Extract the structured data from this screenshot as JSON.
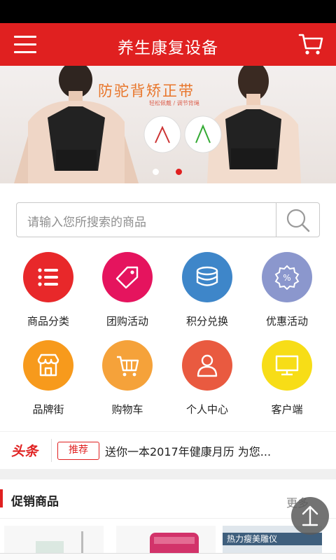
{
  "header": {
    "title": "养生康复设备",
    "menu_icon": "menu-icon",
    "cart_icon": "cart-icon",
    "color": "#e02020"
  },
  "banner": {
    "headline": "防驼背矫正带",
    "sub_text": "轻松佩戴 / 调节背绳",
    "active_dot": 2,
    "dot_count": 2
  },
  "search": {
    "placeholder": "请输入您所搜索的商品",
    "icon": "search-icon"
  },
  "categories": [
    {
      "label": "商品分类",
      "icon": "list-icon",
      "color": "#e8282a"
    },
    {
      "label": "团购活动",
      "icon": "tag-icon",
      "color": "#e5145e"
    },
    {
      "label": "积分兑换",
      "icon": "coins-icon",
      "color": "#3e86c9"
    },
    {
      "label": "优惠活动",
      "icon": "discount-icon",
      "color": "#8b97cd"
    },
    {
      "label": "品牌街",
      "icon": "shop-icon",
      "color": "#f79a1c"
    },
    {
      "label": "购物车",
      "icon": "cart-icon",
      "color": "#f5a23a"
    },
    {
      "label": "个人中心",
      "icon": "user-icon",
      "color": "#e95a40"
    },
    {
      "label": "客户端",
      "icon": "monitor-icon",
      "color": "#f7dd17"
    }
  ],
  "news": {
    "tag": "头条",
    "badge": "推荐",
    "text": "送你一本2017年健康月历 为您..."
  },
  "promo": {
    "title": "促销商品",
    "more": "更多",
    "product_3_caption": "热力瘦美雕仪"
  },
  "fab": {
    "icon": "arrow-up-icon"
  }
}
